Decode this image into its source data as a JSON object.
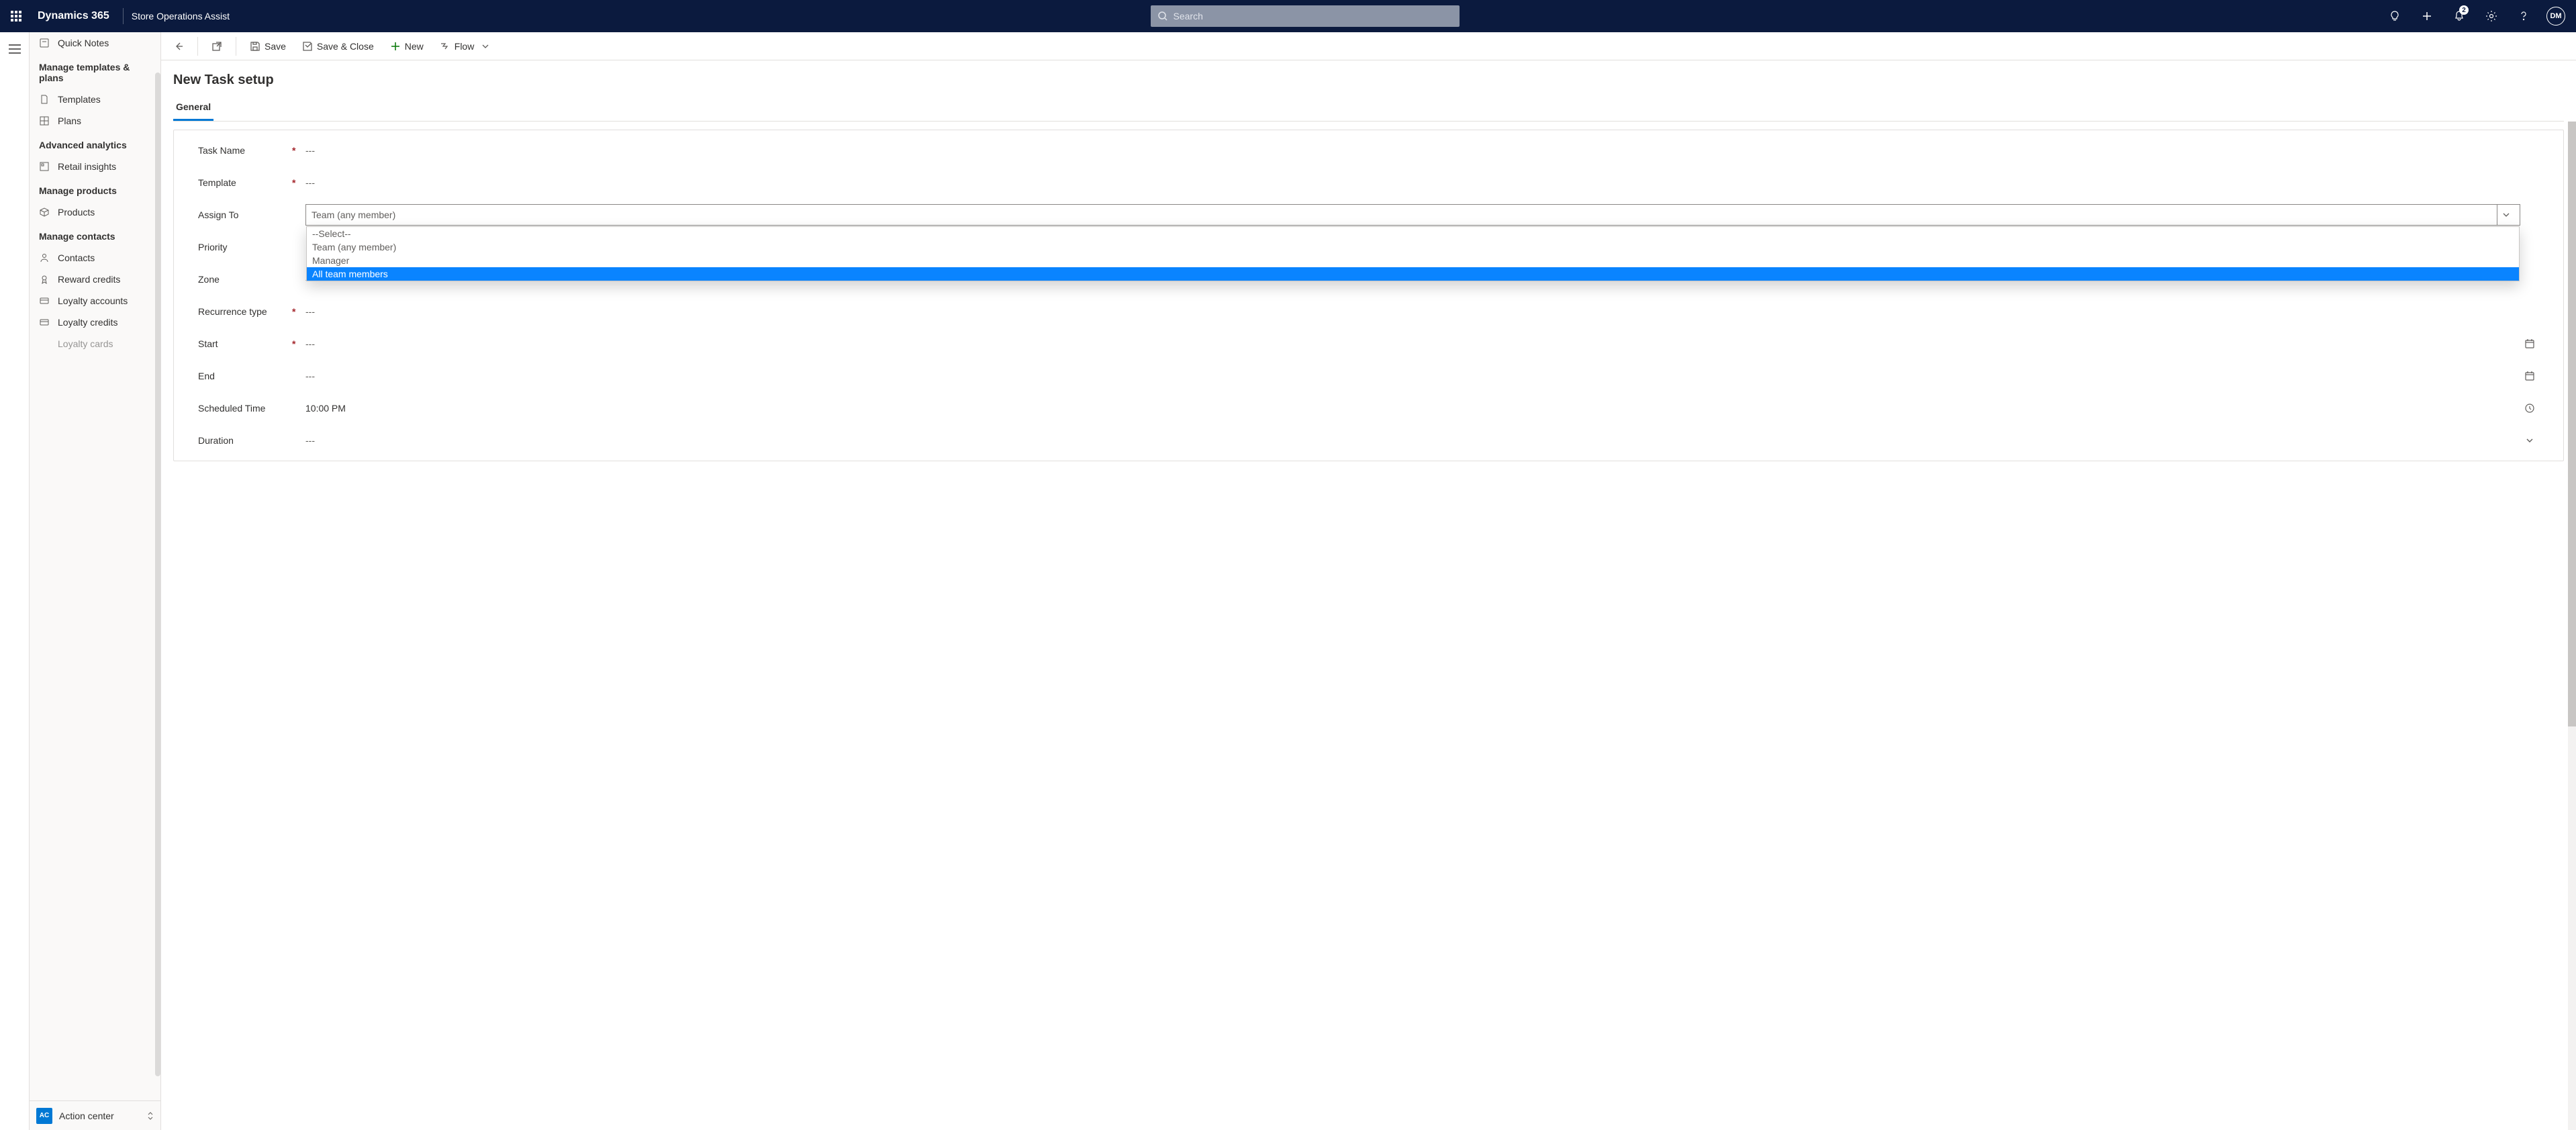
{
  "topbar": {
    "brand": "Dynamics 365",
    "app_name": "Store Operations Assist",
    "search_placeholder": "Search",
    "notification_count": "2",
    "avatar_initials": "DM"
  },
  "sidebar": {
    "quick_notes": "Quick Notes",
    "section_templates": "Manage templates & plans",
    "templates": "Templates",
    "plans": "Plans",
    "section_analytics": "Advanced analytics",
    "retail_insights": "Retail insights",
    "section_products": "Manage products",
    "products": "Products",
    "section_contacts": "Manage contacts",
    "contacts": "Contacts",
    "reward_credits": "Reward credits",
    "loyalty_accounts": "Loyalty accounts",
    "loyalty_credits": "Loyalty credits",
    "loyalty_cards": "Loyalty cards",
    "action_center_badge": "AC",
    "action_center": "Action center"
  },
  "cmdbar": {
    "save": "Save",
    "save_close": "Save & Close",
    "new": "New",
    "flow": "Flow"
  },
  "page": {
    "title": "New Task setup",
    "tab_general": "General"
  },
  "form": {
    "task_name": {
      "label": "Task Name",
      "value": "---"
    },
    "template": {
      "label": "Template",
      "value": "---"
    },
    "assign_to": {
      "label": "Assign To",
      "value": "Team (any member)",
      "options": [
        "--Select--",
        "Team (any member)",
        "Manager",
        "All team members"
      ],
      "highlighted": "All team members"
    },
    "priority": {
      "label": "Priority"
    },
    "zone": {
      "label": "Zone",
      "value": "---"
    },
    "recurrence": {
      "label": "Recurrence type",
      "value": "---"
    },
    "start": {
      "label": "Start",
      "value": "---"
    },
    "end": {
      "label": "End",
      "value": "---"
    },
    "scheduled_time": {
      "label": "Scheduled Time",
      "value": "10:00 PM"
    },
    "duration": {
      "label": "Duration",
      "value": "---"
    }
  }
}
